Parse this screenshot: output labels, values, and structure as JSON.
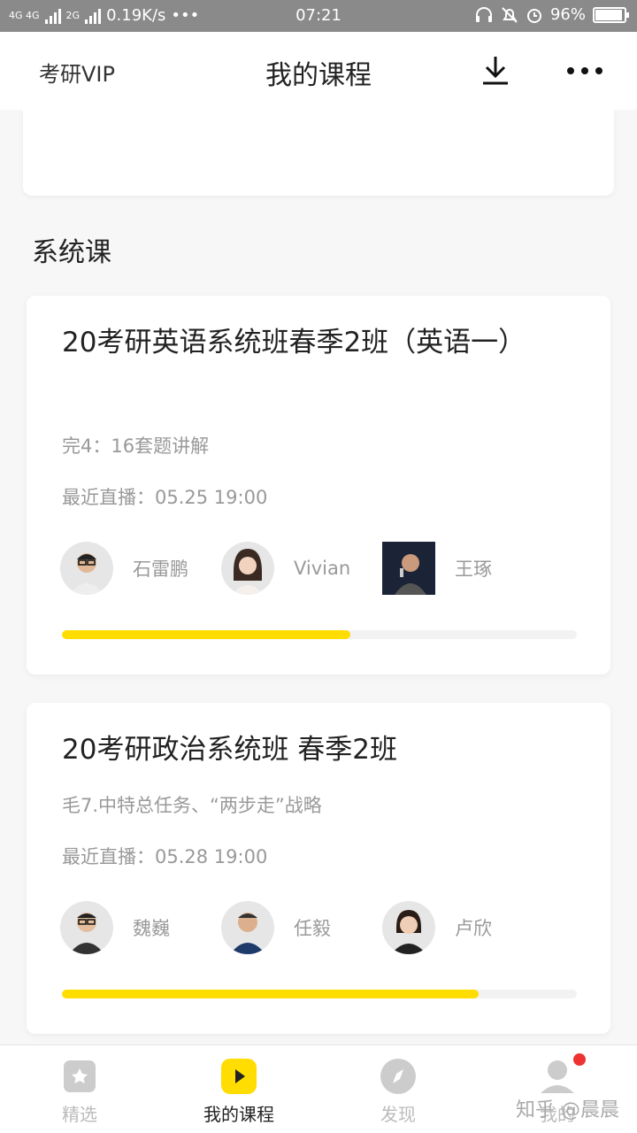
{
  "status_bar": {
    "network_left": "4G 4G",
    "network_2g": "2G",
    "speed": "0.19K/s",
    "dots": "•••",
    "time": "07:21",
    "battery": "96%"
  },
  "navbar": {
    "left_label": "考研VIP",
    "title": "我的课程"
  },
  "section_title": "系统课",
  "courses": [
    {
      "title": "20考研英语系统班春季2班（英语一）",
      "progress_text": "完4：16套题讲解",
      "latest_live": "最近直播：05.25 19:00",
      "teachers": [
        "石雷鹏",
        "Vivian",
        "王琢"
      ],
      "progress": 0.56
    },
    {
      "title": "20考研政治系统班 春季2班",
      "progress_text": "毛7.中特总任务、“两步走”战略",
      "latest_live": "最近直播：05.28 19:00",
      "teachers": [
        "魏巍",
        "任毅",
        "卢欣"
      ],
      "progress": 0.81
    }
  ],
  "tabs": [
    {
      "label": "精选",
      "icon": "bookmark-icon"
    },
    {
      "label": "我的课程",
      "icon": "play-icon"
    },
    {
      "label": "发现",
      "icon": "compass-icon"
    },
    {
      "label": "我的",
      "icon": "profile-icon"
    }
  ],
  "watermark": "知乎 @晨晨",
  "colors": {
    "accent": "#FFDD00",
    "badge": "#EE3333"
  }
}
